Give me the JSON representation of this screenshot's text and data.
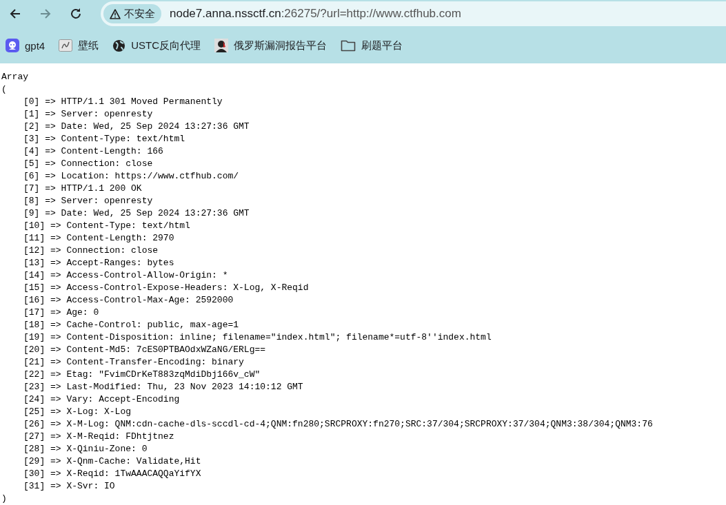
{
  "toolbar": {
    "nav_buttons": [
      {
        "kind": "back",
        "disabled": false
      },
      {
        "kind": "forward",
        "disabled": true
      },
      {
        "kind": "reload",
        "disabled": false
      }
    ],
    "security_chip": "不安全",
    "address": {
      "host": "node7.anna.nssctf.cn",
      "rest": ":26275/?url=http://www.ctfhub.com"
    }
  },
  "bookmarks": [
    {
      "kind": "bot",
      "label": "gpt4"
    },
    {
      "kind": "image",
      "label": "壁纸"
    },
    {
      "kind": "globe",
      "label": "USTC反向代理"
    },
    {
      "kind": "avatar",
      "label": "俄罗斯漏洞报告平台"
    },
    {
      "kind": "folder",
      "label": "刷题平台"
    }
  ],
  "output": {
    "open": [
      "Array",
      "("
    ],
    "lines": [
      "[0] => HTTP/1.1 301 Moved Permanently",
      "[1] => Server: openresty",
      "[2] => Date: Wed, 25 Sep 2024 13:27:36 GMT",
      "[3] => Content-Type: text/html",
      "[4] => Content-Length: 166",
      "[5] => Connection: close",
      "[6] => Location: https://www.ctfhub.com/",
      "[7] => HTTP/1.1 200 OK",
      "[8] => Server: openresty",
      "[9] => Date: Wed, 25 Sep 2024 13:27:36 GMT",
      "[10] => Content-Type: text/html",
      "[11] => Content-Length: 2970",
      "[12] => Connection: close",
      "[13] => Accept-Ranges: bytes",
      "[14] => Access-Control-Allow-Origin: *",
      "[15] => Access-Control-Expose-Headers: X-Log, X-Reqid",
      "[16] => Access-Control-Max-Age: 2592000",
      "[17] => Age: 0",
      "[18] => Cache-Control: public, max-age=1",
      "[19] => Content-Disposition: inline; filename=\"index.html\"; filename*=utf-8''index.html",
      "[20] => Content-Md5: 7cES0PTBAOdxWZaNG/ERLg==",
      "[21] => Content-Transfer-Encoding: binary",
      "[22] => Etag: \"FvimCDrKeT883zqMdiDbj166v_cW\"",
      "[23] => Last-Modified: Thu, 23 Nov 2023 14:10:12 GMT",
      "[24] => Vary: Accept-Encoding",
      "[25] => X-Log: X-Log",
      "[26] => X-M-Log: QNM:cdn-cache-dls-sccdl-cd-4;QNM:fn280;SRCPROXY:fn270;SRC:37/304;SRCPROXY:37/304;QNM3:38/304;QNM3:76",
      "[27] => X-M-Reqid: FDhtjtnez",
      "[28] => X-Qiniu-Zone: 0",
      "[29] => X-Qnm-Cache: Validate,Hit",
      "[30] => X-Reqid: 1TwAAACAQQaYifYX",
      "[31] => X-Svr: IO"
    ],
    "close": ")"
  }
}
